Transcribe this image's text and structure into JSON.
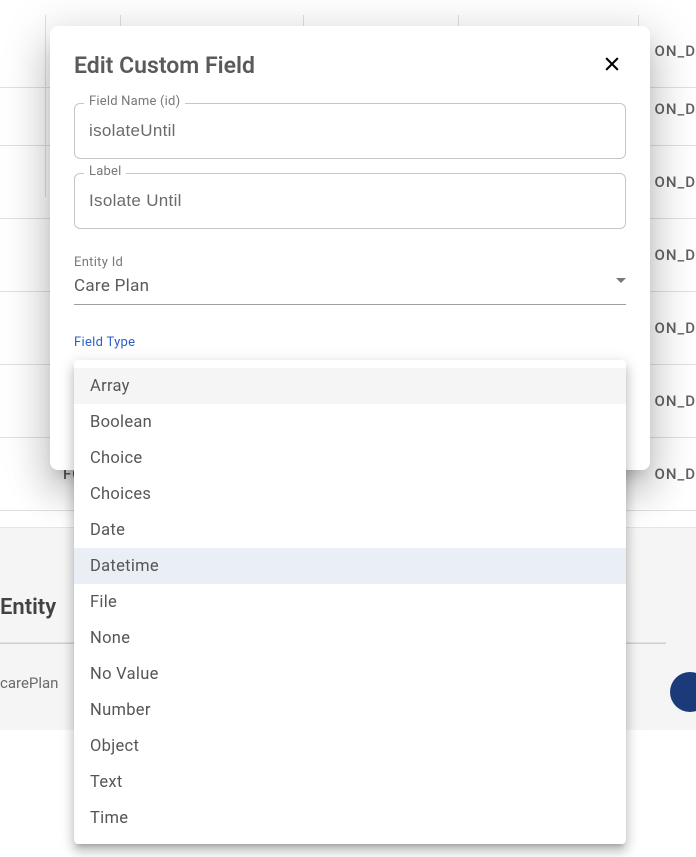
{
  "background": {
    "ond_text": "ON_D",
    "fo_text": "FO",
    "entity_title": "Entity",
    "entity_value": "carePlan"
  },
  "modal": {
    "title": "Edit Custom Field",
    "field_name": {
      "label": "Field Name (id)",
      "value": "isolateUntil"
    },
    "label_field": {
      "label": "Label",
      "value": "Isolate Until"
    },
    "entity_id": {
      "label": "Entity Id",
      "value": "Care Plan"
    },
    "field_type": {
      "label": "Field Type",
      "selected": "Datetime",
      "options": [
        "Array",
        "Boolean",
        "Choice",
        "Choices",
        "Date",
        "Datetime",
        "File",
        "None",
        "No Value",
        "Number",
        "Object",
        "Text",
        "Time"
      ]
    }
  }
}
